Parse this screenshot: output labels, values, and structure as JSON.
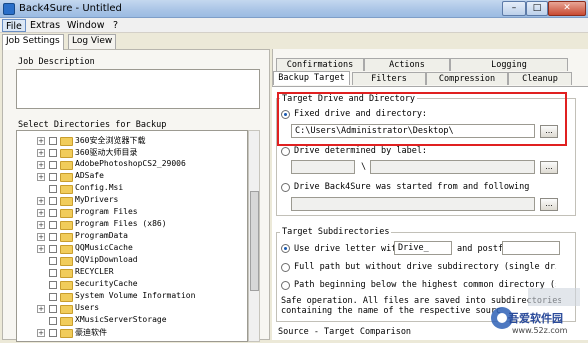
{
  "window": {
    "title": "Back4Sure - Untitled",
    "min": "–",
    "max": "□",
    "close": "✕"
  },
  "menu": [
    "File",
    "Extras",
    "Window",
    "?"
  ],
  "tabs": [
    "Job Settings",
    "Log View"
  ],
  "left": {
    "job_description_label": "Job Description",
    "select_dirs_label": "Select Directories for Backup",
    "tree": [
      "360安全浏览器下载",
      "360驱动大师目录",
      "AdobePhotoshopCS2_29006",
      "ADSafe",
      "Config.Msi",
      "MyDrivers",
      "Program Files",
      "Program Files (x86)",
      "ProgramData",
      "QQMusicCache",
      "QQVipDownload",
      "RECYCLER",
      "SecurityCache",
      "System Volume Information",
      "Users",
      "XMusicServerStorage",
      "豪迪软件"
    ]
  },
  "right": {
    "tabs_row1": [
      "Confirmations",
      "Actions",
      "Logging"
    ],
    "tabs_row2": [
      "Backup Target",
      "Filters",
      "Compression",
      "Cleanup"
    ],
    "target_drive_group": "Target Drive and Directory",
    "fixed_drive_label": "Fixed drive and directory:",
    "fixed_drive_value": "C:\\Users\\Administrator\\Desktop\\",
    "drive_by_label": "Drive determined by label:",
    "backslash": "\\",
    "drive_started_from": "Drive Back4Sure was started from and following",
    "browse": "...",
    "target_subdirs_group": "Target Subdirectories",
    "use_drive_letter_label": "Use drive letter with",
    "drive_prefix": "Drive_",
    "and_postf": "and postf",
    "full_path_label": "Full path but without drive subdirectory (single drive only)",
    "path_beginning_label": "Path beginning below the highest common directory (single dr",
    "safe_op_line1": "Safe operation. All files are saved into subdirectories",
    "safe_op_line2": "containing the name of the respective source drive",
    "comparison_group": "Source - Target Comparison"
  },
  "watermark": {
    "text": "吾爱软件园",
    "url": "www.52z.com"
  }
}
